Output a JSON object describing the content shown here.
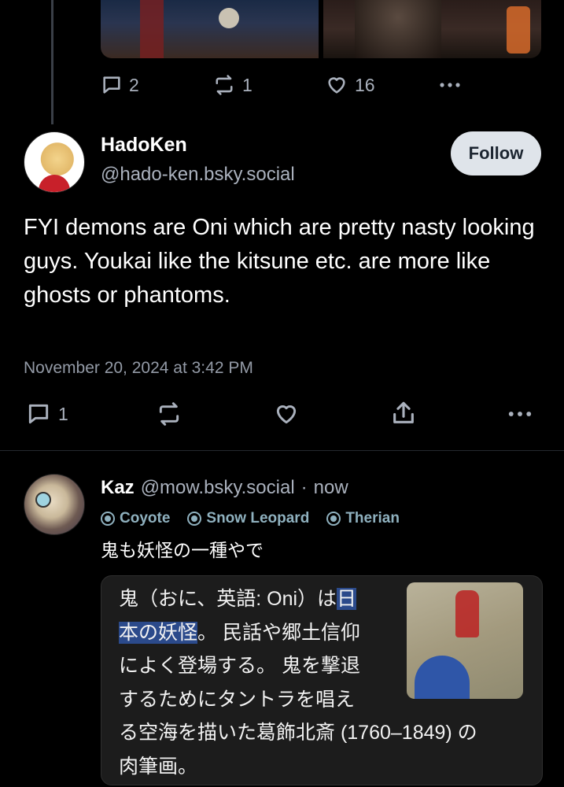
{
  "previous_post": {
    "actions": {
      "reply_count": "2",
      "repost_count": "1",
      "like_count": "16"
    }
  },
  "main_post": {
    "author_name": "HadoKen",
    "author_handle": "@hado-ken.bsky.social",
    "follow_label": "Follow",
    "text": "FYI demons are Oni which are pretty nasty looking guys. Youkai like the kitsune etc. are more like ghosts or phantoms.",
    "timestamp": "November 20, 2024 at 3:42 PM",
    "reply_count": "1"
  },
  "reply": {
    "author_name": "Kaz",
    "author_handle": "@mow.bsky.social",
    "separator": "·",
    "time": "now",
    "badges": [
      "Coyote",
      "Snow Leopard",
      "Therian"
    ],
    "text": "鬼も妖怪の一種やで",
    "quote": {
      "lines": [
        "鬼（おに、英語: Oni）は",
        "日",
        "本の妖怪",
        "。 民話や郷土信仰",
        "によく登場する。 鬼を撃退",
        "するためにタントラを唱え",
        "る空海を描いた葛飾北斎 (1760–1849) の",
        "肉筆画。"
      ]
    }
  },
  "colors": {
    "background": "#000000",
    "muted_text": "#aab1bd",
    "badge": "#8fb1bf",
    "highlight": "#2b4a8b",
    "follow_button": "#dfe4ea"
  }
}
